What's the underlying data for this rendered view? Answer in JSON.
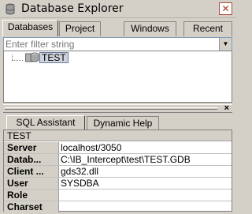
{
  "window": {
    "title": "Database Explorer",
    "close_glyph": "✕",
    "title_icon": "database-explorer-icon"
  },
  "tabs": [
    {
      "label": "Databases",
      "active": true
    },
    {
      "label": "Project",
      "active": false
    },
    {
      "label": "Windows",
      "active": false
    },
    {
      "label": "Recent",
      "active": false
    }
  ],
  "filter": {
    "placeholder": "Enter filter string",
    "dropdown_glyph": "▼"
  },
  "tree": {
    "nodes": [
      {
        "label": "TEST",
        "icon": "database-icon",
        "selected": true
      }
    ]
  },
  "splitter": {
    "close_glyph": "×"
  },
  "bottom_tabs": [
    {
      "label": "SQL Assistant",
      "active": true
    },
    {
      "label": "Dynamic Help",
      "active": false
    }
  ],
  "properties": {
    "header": "TEST",
    "rows": [
      {
        "key": "Server",
        "value": "localhost/3050"
      },
      {
        "key": "Datab...",
        "value": "C:\\IB_Intercept\\test\\TEST.GDB"
      },
      {
        "key": "Client ...",
        "value": "gds32.dll"
      },
      {
        "key": "User",
        "value": "SYSDBA"
      },
      {
        "key": "Role",
        "value": ""
      },
      {
        "key": "Charset",
        "value": ""
      }
    ]
  }
}
